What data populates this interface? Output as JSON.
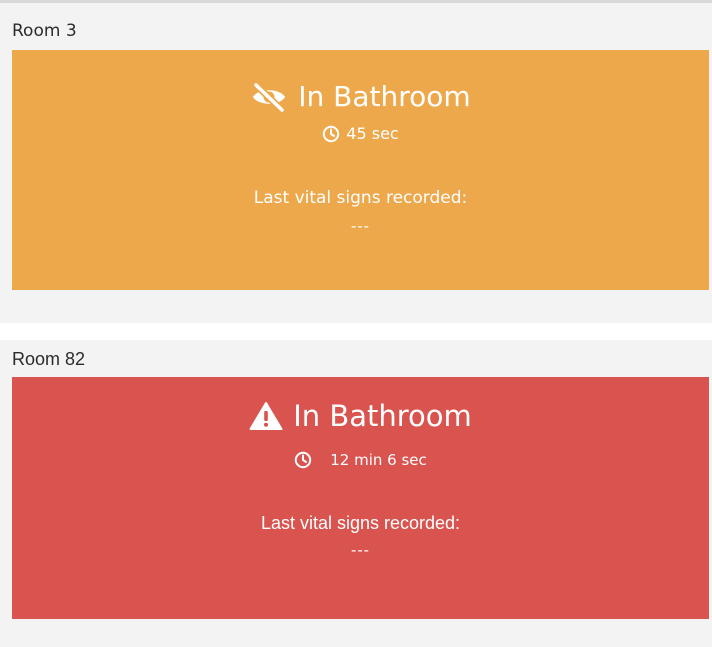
{
  "rooms": [
    {
      "label": "Room 3",
      "status": "In Bathroom",
      "status_icon": "eye-slash-icon",
      "timer_icon": "clock-icon",
      "duration": "45 sec",
      "vitals_label": "Last vital signs recorded:",
      "vitals_value": "---",
      "panel_color": "#eea84c"
    },
    {
      "label": "Room 82",
      "status": "In Bathroom",
      "status_icon": "warning-triangle-icon",
      "timer_icon": "clock-icon",
      "duration": "12 min 6 sec",
      "vitals_label": "Last vital signs recorded:",
      "vitals_value": "---",
      "panel_color": "#d9534f"
    }
  ]
}
